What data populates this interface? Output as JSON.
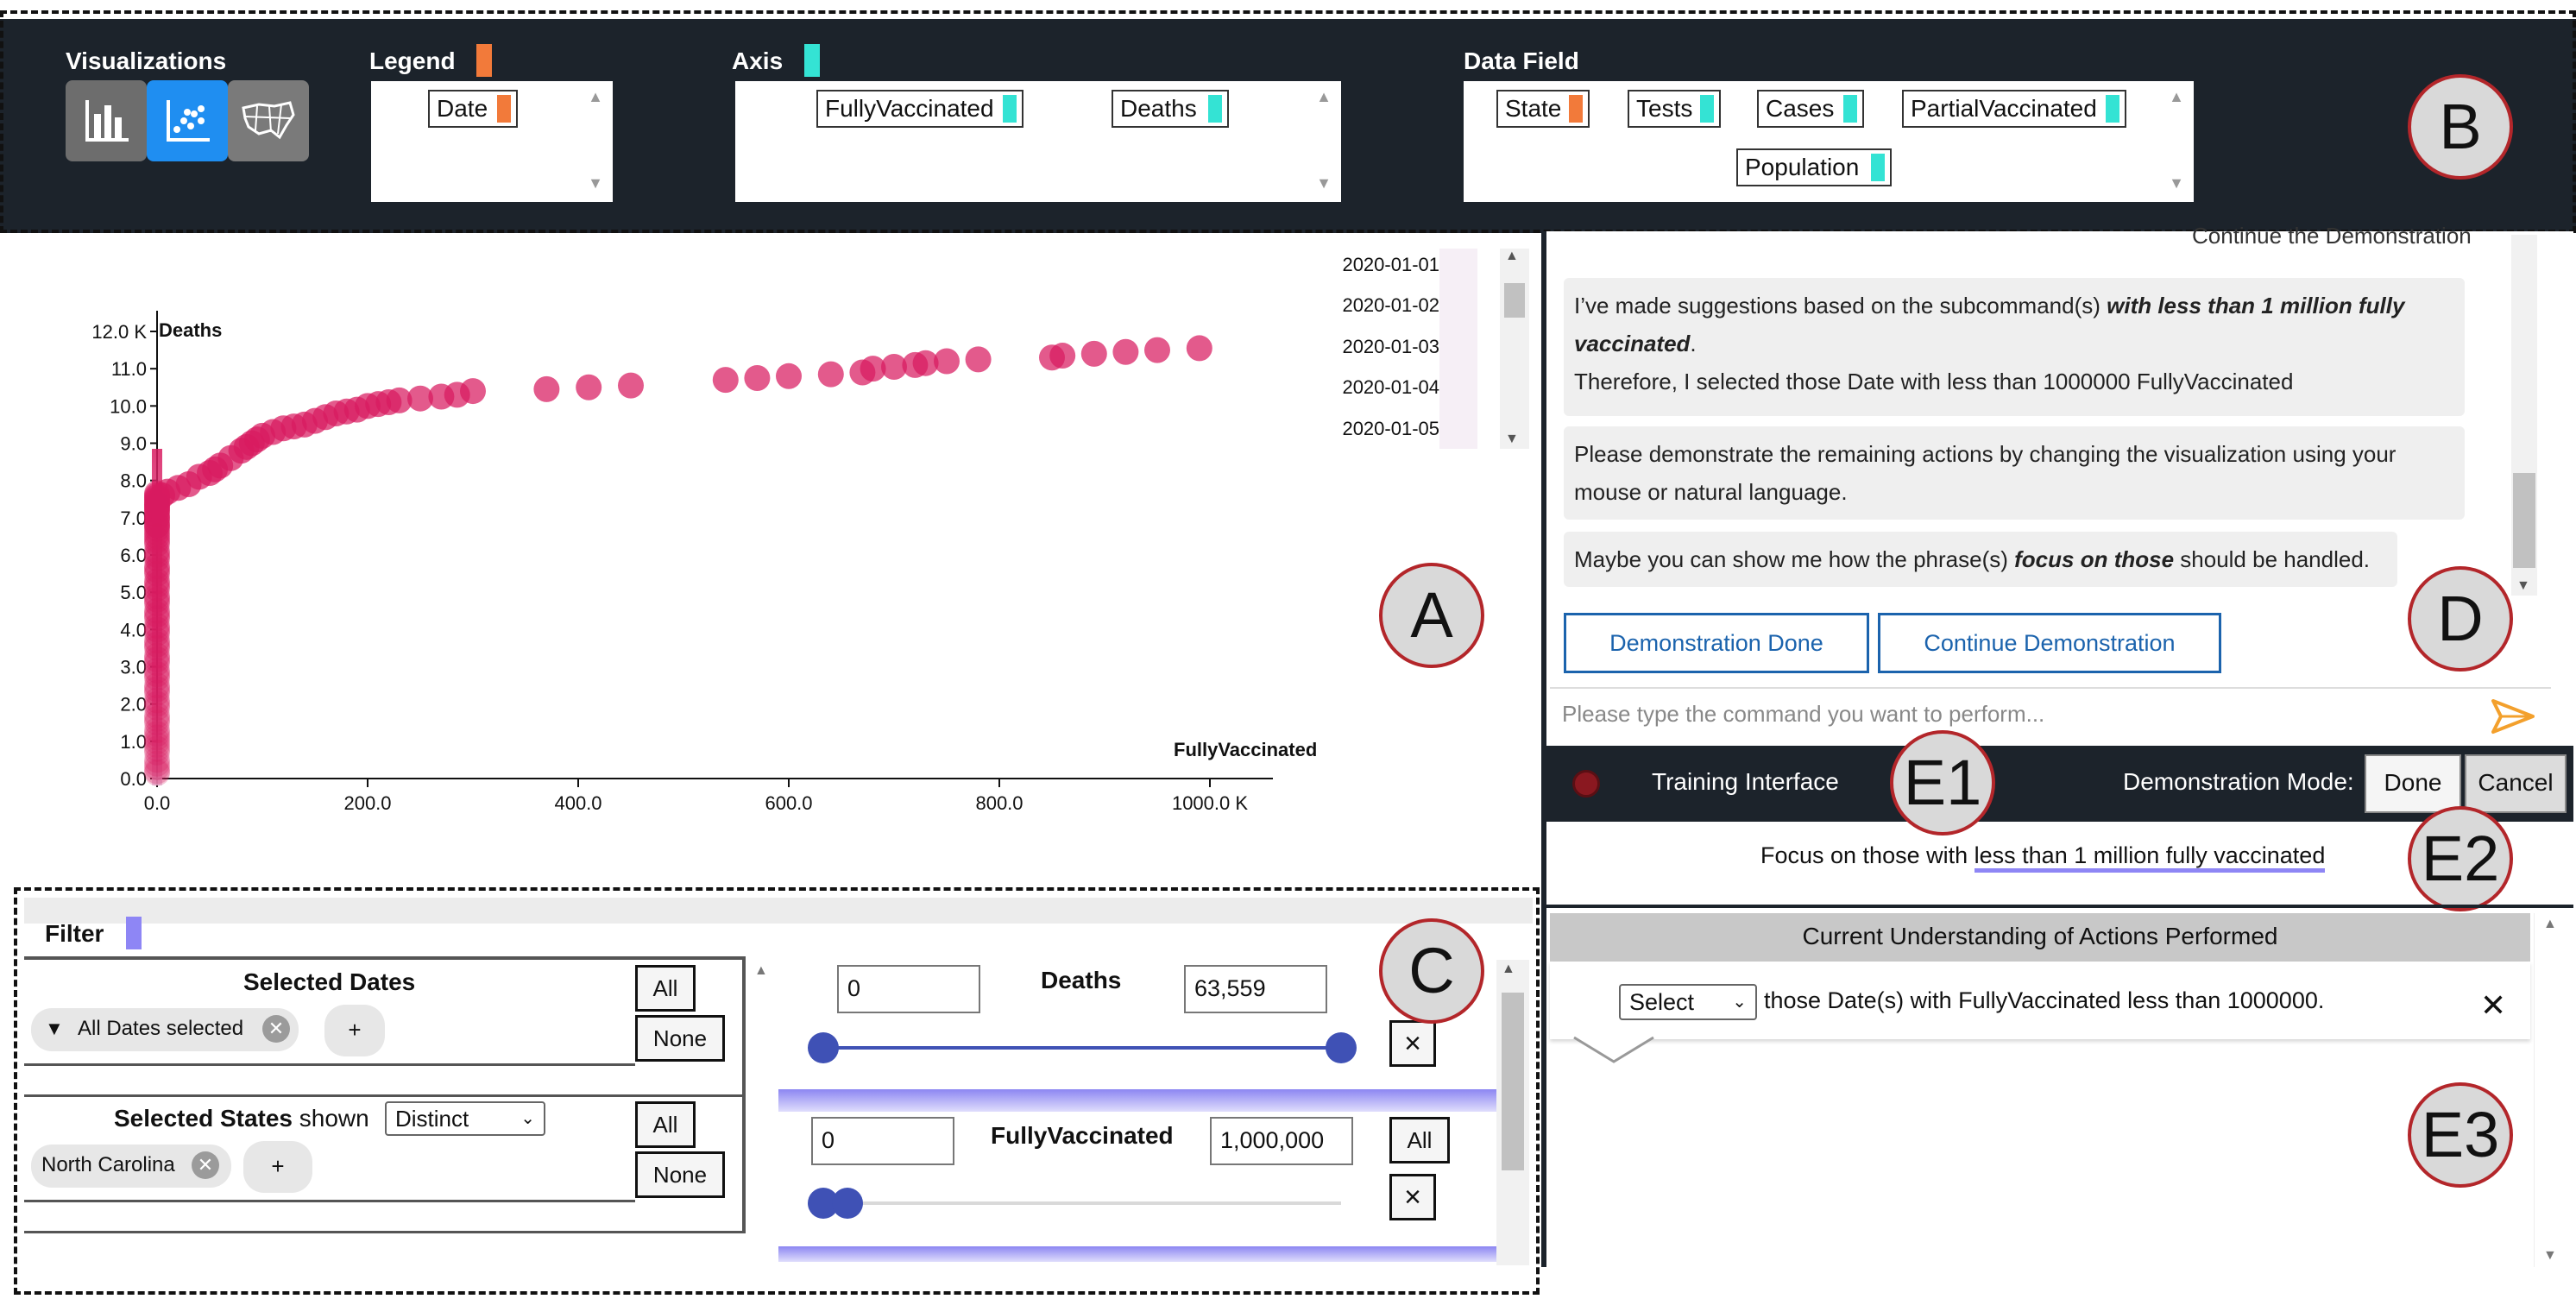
{
  "toolbar": {
    "visualizations_title": "Visualizations",
    "legend_title": "Legend",
    "axis_title": "Axis",
    "data_field_title": "Data Field",
    "legend_items": [
      "Date"
    ],
    "axis_items": [
      "FullyVaccinated",
      "Deaths"
    ],
    "data_field_items": [
      "State",
      "Tests",
      "Cases",
      "PartialVaccinated",
      "Population"
    ],
    "viz_icons": [
      "bar-chart-icon",
      "scatter-plot-icon",
      "map-icon"
    ],
    "selected_viz": "scatter-plot-icon"
  },
  "labels": {
    "a": "A",
    "b": "B",
    "c": "C",
    "d": "D",
    "e1": "E1",
    "e2": "E2",
    "e3": "E3"
  },
  "chart_data": {
    "type": "scatter",
    "xlabel": "FullyVaccinated",
    "ylabel": "Deaths",
    "x_ticks": [
      "0.0",
      "200.0",
      "400.0",
      "600.0",
      "800.0",
      "1000.0 K"
    ],
    "y_ticks": [
      "0.0",
      "1.0",
      "2.0",
      "3.0",
      "4.0",
      "5.0",
      "6.0",
      "7.0",
      "8.0",
      "9.0",
      "10.0",
      "11.0",
      "12.0 K"
    ],
    "xlim": [
      0,
      1000000
    ],
    "ylim": [
      0,
      12000
    ],
    "x": [
      0,
      0,
      0,
      0,
      0,
      0,
      0,
      0,
      0,
      0,
      0,
      0,
      0,
      0,
      0,
      0,
      0,
      0,
      0,
      0,
      0,
      0,
      0,
      0,
      0,
      0,
      0,
      0,
      0,
      0,
      0,
      0,
      0,
      0,
      0,
      0,
      0,
      0,
      0,
      0,
      0,
      0,
      0,
      0,
      0,
      0,
      0,
      0,
      0,
      0,
      0,
      0,
      0,
      0,
      0,
      0,
      0,
      0,
      0,
      0,
      0,
      0,
      0,
      0,
      0,
      0,
      0,
      0,
      0,
      0,
      5000,
      10000,
      20000,
      30000,
      40000,
      50000,
      55000,
      60000,
      70000,
      80000,
      85000,
      90000,
      95000,
      100000,
      110000,
      120000,
      130000,
      140000,
      150000,
      160000,
      170000,
      180000,
      190000,
      200000,
      210000,
      220000,
      230000,
      250000,
      270000,
      285000,
      300000,
      370000,
      410000,
      450000,
      540000,
      570000,
      600000,
      640000,
      670000,
      680000,
      700000,
      720000,
      730000,
      750000,
      780000,
      850000,
      860000,
      890000,
      920000,
      950000,
      990000
    ],
    "y": [
      300,
      500,
      700,
      900,
      1100,
      1300,
      1500,
      1700,
      1900,
      2100,
      2300,
      2500,
      2700,
      2900,
      3100,
      3300,
      3500,
      3700,
      3900,
      4100,
      4300,
      4500,
      4700,
      4900,
      5100,
      5300,
      5500,
      5700,
      5900,
      6100,
      6300,
      6500,
      6600,
      6700,
      6800,
      6900,
      7000,
      7100,
      7200,
      7300,
      7350,
      7400,
      7450,
      7500,
      7550,
      7600,
      7650,
      1000,
      2000,
      4000,
      6000,
      7000,
      7200,
      7300,
      400,
      800,
      1200,
      1600,
      2400,
      2800,
      3200,
      3600,
      4400,
      4800,
      5200,
      5600,
      6400,
      6800,
      150,
      200,
      7600,
      7700,
      7800,
      7900,
      8100,
      8200,
      8300,
      8400,
      8600,
      8800,
      8900,
      9000,
      9100,
      9200,
      9300,
      9400,
      9450,
      9500,
      9600,
      9700,
      9800,
      9850,
      9900,
      10000,
      10050,
      10100,
      10150,
      10200,
      10250,
      10300,
      10400,
      10450,
      10500,
      10550,
      10700,
      10750,
      10800,
      10850,
      10900,
      11000,
      11050,
      11100,
      11150,
      11200,
      11250,
      11300,
      11350,
      11400,
      11450,
      11500,
      11550
    ]
  },
  "date_list": [
    "2020-01-01",
    "2020-01-02",
    "2020-01-03",
    "2020-01-04",
    "2020-01-05"
  ],
  "filter": {
    "title": "Filter",
    "selected_dates_label": "Selected Dates",
    "dates_chip": "All Dates selected",
    "selected_states_label": "Selected States",
    "shown_label": "shown",
    "distinct_option": "Distinct",
    "states_chip": "North Carolina",
    "all_label": "All",
    "none_label": "None",
    "plus": "+",
    "close": "×",
    "deaths_title": "Deaths",
    "deaths_min": "0",
    "deaths_max": "63,559",
    "fv_title": "FullyVaccinated",
    "fv_min": "0",
    "fv_max": "1,000,000"
  },
  "chat": {
    "header_partial": "Continue the Demonstration",
    "msg1_pre": "I’ve made suggestions based on the subcommand(s) ",
    "msg1_bold": "with less than 1 million fully vaccinated",
    "msg1_post": ".",
    "msg1_line2": "Therefore, I selected those Date with less than 1000000 FullyVaccinated",
    "msg2": "Please demonstrate the remaining actions by changing the visualization using your mouse or natural language.",
    "msg3_pre": "Maybe you can show me how the phrase(s) ",
    "msg3_bold": "focus on those",
    "msg3_post": " should be handled.",
    "btn_done": "Demonstration Done",
    "btn_continue": "Continue Demonstration",
    "input_placeholder": "Please type the command you want to perform..."
  },
  "training": {
    "label": "Training Interface",
    "mode_label": "Demonstration Mode:",
    "done": "Done",
    "cancel": "Cancel"
  },
  "command": {
    "prefix": "Focus on those with ",
    "underlined": "less than 1 million fully vaccinated"
  },
  "understanding": {
    "header": "Current Understanding of Actions Performed",
    "select_value": "Select",
    "text": "those Date(s) with FullyVaccinated less than 1000000."
  }
}
